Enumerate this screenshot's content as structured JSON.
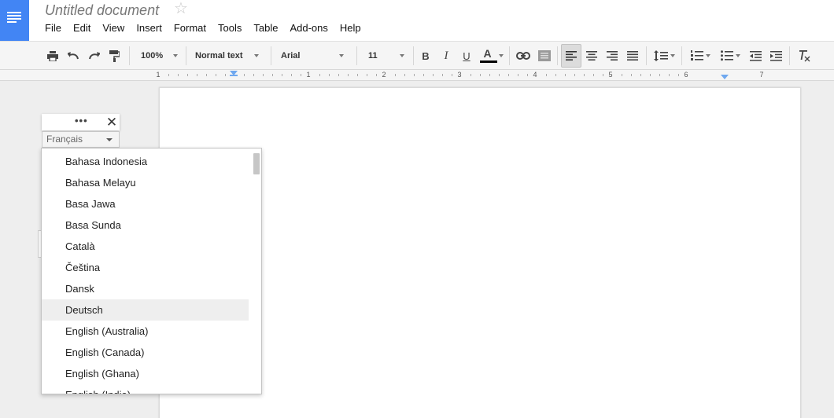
{
  "header": {
    "title": "Untitled document",
    "menu": [
      "File",
      "Edit",
      "View",
      "Insert",
      "Format",
      "Tools",
      "Table",
      "Add-ons",
      "Help"
    ]
  },
  "toolbar": {
    "zoom": "100%",
    "style": "Normal text",
    "font": "Arial",
    "font_size": "11",
    "bold_label": "B",
    "italic_label": "I",
    "underline_label": "U",
    "text_color_label": "A",
    "text_color": "#000000",
    "active_alignment": "left"
  },
  "ruler": {
    "numbers": [
      "1",
      "1",
      "2",
      "3",
      "4",
      "5",
      "6",
      "7"
    ]
  },
  "widget": {
    "dots": "•••",
    "close": "✕",
    "selected_language": "Français"
  },
  "language_list": {
    "items": [
      "Bahasa Indonesia",
      "Bahasa Melayu",
      "Basa Jawa",
      "Basa Sunda",
      "Català",
      "Čeština",
      "Dansk",
      "Deutsch",
      "English (Australia)",
      "English (Canada)",
      "English (Ghana)",
      "English (India)"
    ],
    "highlighted": "Deutsch"
  },
  "colors": {
    "brand": "#4285f4",
    "ruler_marker": "#6fa8ef"
  }
}
